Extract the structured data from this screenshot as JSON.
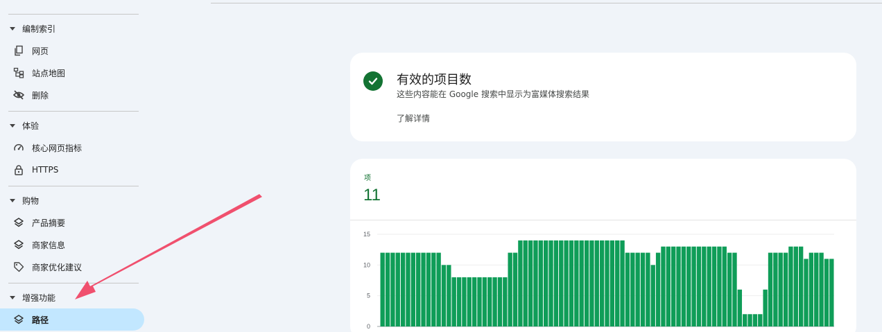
{
  "sidebar": {
    "sections": [
      {
        "title": "编制索引",
        "items": [
          {
            "label": "网页",
            "icon": "pages-icon"
          },
          {
            "label": "站点地图",
            "icon": "sitemap-icon"
          },
          {
            "label": "删除",
            "icon": "visibility-off-icon"
          }
        ]
      },
      {
        "title": "体验",
        "items": [
          {
            "label": "核心网页指标",
            "icon": "speed-icon"
          },
          {
            "label": "HTTPS",
            "icon": "lock-icon"
          }
        ]
      },
      {
        "title": "购物",
        "items": [
          {
            "label": "产品摘要",
            "icon": "layers-icon"
          },
          {
            "label": "商家信息",
            "icon": "layers-icon"
          },
          {
            "label": "商家优化建议",
            "icon": "tag-icon"
          }
        ]
      },
      {
        "title": "增强功能",
        "items": [
          {
            "label": "路径",
            "icon": "layers-icon",
            "active": true
          }
        ]
      }
    ]
  },
  "valid": {
    "title": "有效的项目数",
    "description": "这些内容能在 Google 搜索中显示为富媒体搜索结果",
    "learn_more": "了解详情"
  },
  "summary": {
    "label": "项",
    "count": "11"
  },
  "colors": {
    "accent_green": "#137333",
    "bar_green": "#0f9d58",
    "active_bg": "#c2e7ff",
    "annotation": "#f0506e"
  },
  "chart_data": {
    "type": "bar",
    "ylim": [
      0,
      15
    ],
    "yticks": [
      "15",
      "10",
      "5",
      "0"
    ],
    "values": [
      12,
      12,
      12,
      12,
      12,
      12,
      12,
      12,
      12,
      12,
      12,
      12,
      10,
      10,
      8,
      8,
      8,
      8,
      8,
      8,
      8,
      8,
      8,
      8,
      8,
      12,
      12,
      14,
      14,
      14,
      14,
      14,
      14,
      14,
      14,
      14,
      14,
      14,
      14,
      14,
      14,
      14,
      14,
      14,
      14,
      14,
      14,
      14,
      12,
      12,
      12,
      12,
      12,
      10,
      12,
      13,
      13,
      13,
      13,
      13,
      13,
      13,
      13,
      13,
      13,
      13,
      13,
      13,
      12,
      12,
      6,
      2,
      2,
      2,
      2,
      6,
      12,
      12,
      12,
      12,
      13,
      13,
      13,
      11,
      12,
      12,
      12,
      11,
      11
    ]
  }
}
